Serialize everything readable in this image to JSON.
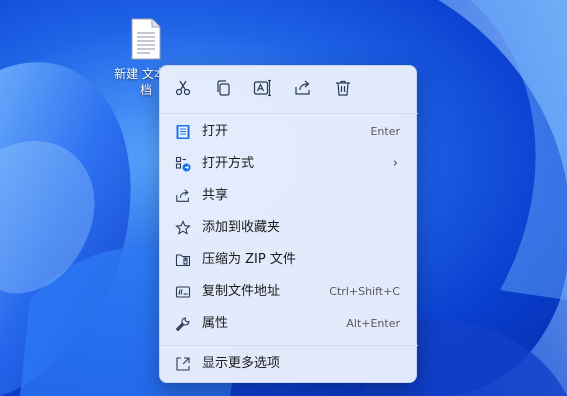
{
  "desktop": {
    "file_icon": "text-document-icon",
    "file_name": "新建 文本文档"
  },
  "context_menu": {
    "toolbar": [
      {
        "name": "cut-button",
        "icon": "scissors-icon"
      },
      {
        "name": "copy-button",
        "icon": "copy-icon"
      },
      {
        "name": "rename-button",
        "icon": "rename-icon"
      },
      {
        "name": "share-button",
        "icon": "share-icon"
      },
      {
        "name": "delete-button",
        "icon": "trash-icon"
      }
    ],
    "items": [
      {
        "label": "打开",
        "shortcut": "Enter",
        "icon": "notepad-icon"
      },
      {
        "label": "打开方式",
        "shortcut": "",
        "icon": "open-with-icon",
        "submenu": true
      },
      {
        "label": "共享",
        "shortcut": "",
        "icon": "share-icon"
      },
      {
        "label": "添加到收藏夹",
        "shortcut": "",
        "icon": "star-icon"
      },
      {
        "label": "压缩为 ZIP 文件",
        "shortcut": "",
        "icon": "zip-folder-icon"
      },
      {
        "label": "复制文件地址",
        "shortcut": "Ctrl+Shift+C",
        "icon": "copy-path-icon"
      },
      {
        "label": "属性",
        "shortcut": "Alt+Enter",
        "icon": "wrench-icon"
      }
    ],
    "more_options": {
      "label": "显示更多选项",
      "icon": "expand-icon"
    },
    "submenu_glyph": "›"
  },
  "colors": {
    "wallpaper_dark": "#062aa6",
    "wallpaper_light": "#5aa7ff",
    "menu_bg": "#e8eefc",
    "icon_stroke": "#2a3a55",
    "accent": "#1a73e8"
  }
}
